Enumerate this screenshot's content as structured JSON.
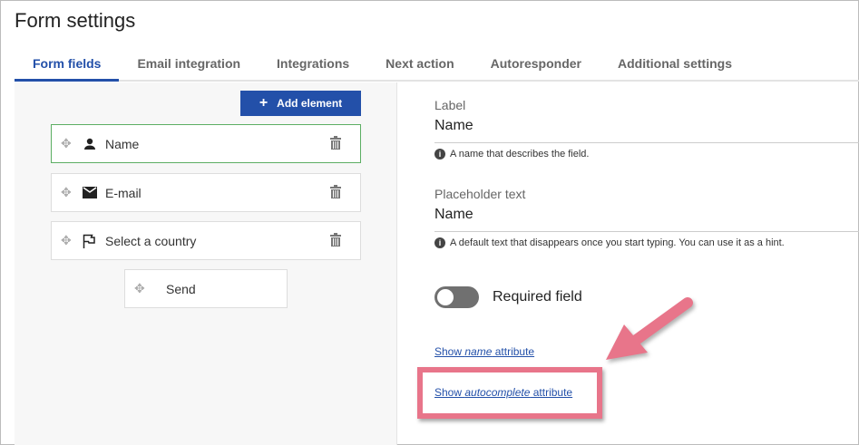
{
  "title": "Form settings",
  "tabs": [
    {
      "label": "Form fields"
    },
    {
      "label": "Email integration"
    },
    {
      "label": "Integrations"
    },
    {
      "label": "Next action"
    },
    {
      "label": "Autoresponder"
    },
    {
      "label": "Additional settings"
    }
  ],
  "left": {
    "add_label": "Add element",
    "elements": [
      {
        "label": "Name",
        "icon": "person-icon"
      },
      {
        "label": "E-mail",
        "icon": "envelope-icon"
      },
      {
        "label": "Select a country",
        "icon": "flag-icon"
      }
    ],
    "send_label": "Send"
  },
  "right": {
    "label_title": "Label",
    "label_value": "Name",
    "label_hint": "A name that describes the field.",
    "ph_title": "Placeholder text",
    "ph_value": "Name",
    "ph_hint": "A default text that disappears once you start typing. You can use it as a hint.",
    "required_label": "Required field",
    "required_on": false,
    "link1": {
      "pre": "Show ",
      "em": "name",
      "post": " attribute"
    },
    "link2": {
      "pre": "Show ",
      "em": "autocomplete",
      "post": " attribute"
    }
  },
  "colors": {
    "accent": "#2350a9",
    "annotation": "#e8758a"
  }
}
